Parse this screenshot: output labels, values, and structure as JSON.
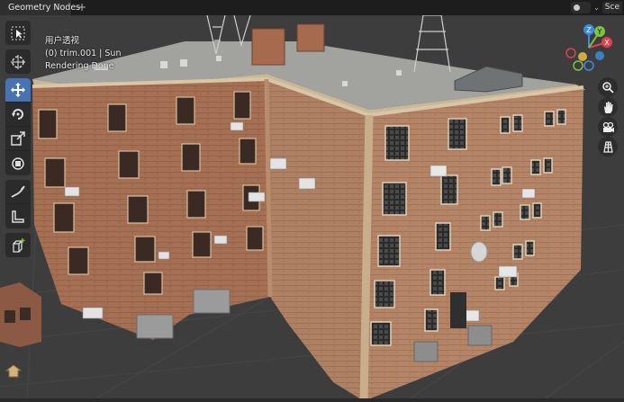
{
  "workspace_tab": "Geometry Nodes",
  "add_tab_symbol": "+",
  "scene_label": "Sce",
  "overlay": {
    "view_name": "用户透视",
    "object_info": "(0) trim.001 | Sun",
    "status": "Rendering Done"
  },
  "gizmo": {
    "x": "X",
    "y": "Y",
    "z": "Z"
  },
  "colors": {
    "active_tool": "#4772b3",
    "x_axis": "#e0404f",
    "y_axis": "#7cc33f",
    "z_axis": "#3c8be0",
    "brick": "#a06a4e",
    "roof": "#9a9a96"
  },
  "toolbar": {
    "tools": [
      "select-box-icon",
      "cursor-icon",
      "move-icon",
      "rotate-icon",
      "scale-icon",
      "transform-icon",
      "annotate-icon",
      "measure-icon",
      "add-cube-icon"
    ],
    "active": "move-icon"
  },
  "nav_buttons": [
    "zoom-icon",
    "pan-hand-icon",
    "camera-icon",
    "grid-icon"
  ]
}
